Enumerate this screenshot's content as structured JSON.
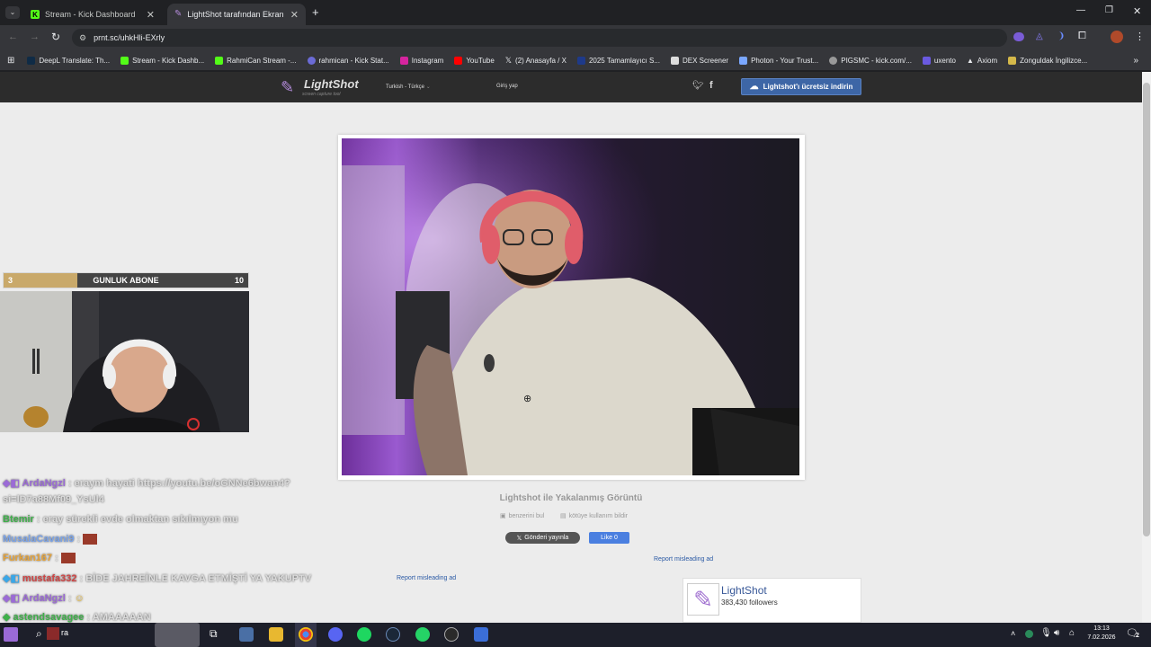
{
  "browser": {
    "tabs": [
      {
        "label": "Stream - Kick Dashboard",
        "active": false
      },
      {
        "label": "LightShot tarafından Ekran Görü",
        "active": true
      }
    ],
    "url": "prnt.sc/uhkHli-EXrly",
    "bookmarks": [
      "DeepL Translate: Th...",
      "Stream - Kick Dashb...",
      "RahmiCan Stream -...",
      "rahmican - Kick Stat...",
      "Instagram",
      "YouTube",
      "(2) Anasayfa / X",
      "2025 Tamamlayıcı S...",
      "DEX Screener",
      "Photon - Your Trust...",
      "PIGSMC - kick.com/...",
      "uxento",
      "Axiom",
      "Zonguldak İngilizce..."
    ]
  },
  "lightshot": {
    "logo": "LightShot",
    "tagline": "screen capture tool",
    "language": "Turkish - Türkçe",
    "login": "Giriş yap",
    "download_button": "Lightshot'ı ücretsiz indirin",
    "page_title": "Lightshot ile Yakalanmış Görüntü",
    "find_similar": "benzerini bul",
    "report_abuse": "kötüye kullanım bildir",
    "tweet_button": "Gönderi yayınla",
    "like_button": "Like 0",
    "report_ad_1": "Report misleading ad",
    "report_ad_2": "Report misleading ad",
    "fb_name": "LightShot",
    "fb_followers": "383,430 followers"
  },
  "stream_overlay": {
    "bar_left": "3",
    "bar_label": "GUNLUK ABONE",
    "bar_right": "10",
    "progress": 0.3
  },
  "chat": [
    {
      "user": "ArdaNgzl",
      "text": ": eraym hayati https://youtu.be/oGNNe6bwan4?",
      "color": "#9b6bd6"
    },
    {
      "user": "",
      "text": "si=lD7a88Mf09_YsUl4",
      "color": "#dcdcdc"
    },
    {
      "user": "Btemir",
      "text": ": eray sürekli evde olmaktan sıkılmıyon mu",
      "color": "#3fb14a"
    },
    {
      "user": "MusalaCavani9",
      "text": ":",
      "color": "#7aa3e8"
    },
    {
      "user": "Furkan167",
      "text": ":",
      "color": "#e7a43a"
    },
    {
      "user": "mustafa332",
      "text": ": BİDE JAHREİNLE KAVGA ETMİŞTİ YA YAKUPTV",
      "color": "#d04545"
    },
    {
      "user": "ArdaNgzl",
      "text": ":",
      "color": "#9b6bd6"
    },
    {
      "user": "astendsavagee",
      "text": ": AMAAAAAN",
      "color": "#3fb14a"
    }
  ],
  "taskbar": {
    "search_text": "ra",
    "time": "13:13",
    "date": "7.02.2026",
    "notifications": "2"
  },
  "colors": {
    "kick_green": "#53fc18",
    "lightshot_button": "#3d66a6",
    "overlay_gold": "#c9a96a"
  }
}
